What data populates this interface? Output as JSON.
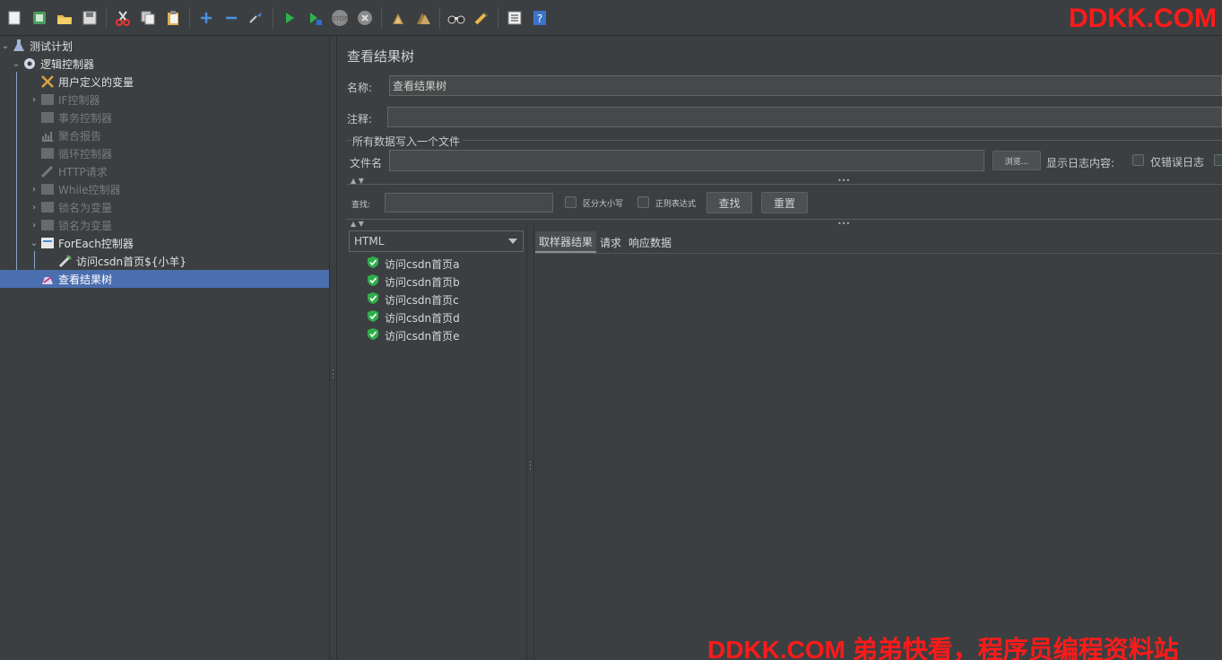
{
  "toolbar": {
    "icons": [
      "new-icon",
      "templates-icon",
      "open-icon",
      "save-icon",
      "cut-icon",
      "copy-icon",
      "paste-icon",
      "expand-icon",
      "collapse-icon",
      "toggle-icon",
      "start-icon",
      "start-no-pause-icon",
      "stop-icon",
      "shutdown-icon",
      "clear-icon",
      "clear-all-icon",
      "search-icon",
      "reset-search-icon",
      "function-helper-icon",
      "help-icon"
    ]
  },
  "watermark_top": "DDKK.COM",
  "tree": {
    "items": [
      {
        "label": "测试计划",
        "icon": "test-plan-icon",
        "disabled": false
      },
      {
        "label": "逻辑控制器",
        "icon": "gear-icon",
        "disabled": false
      },
      {
        "label": "用户定义的变量",
        "icon": "tools-icon",
        "disabled": false
      },
      {
        "label": "IF控制器",
        "icon": "controller-icon",
        "disabled": true
      },
      {
        "label": "事务控制器",
        "icon": "controller-icon",
        "disabled": true
      },
      {
        "label": "聚合报告",
        "icon": "report-icon",
        "disabled": true
      },
      {
        "label": "循环控制器",
        "icon": "controller-icon",
        "disabled": true
      },
      {
        "label": "HTTP请求",
        "icon": "pipette-icon",
        "disabled": true
      },
      {
        "label": "While控制器",
        "icon": "controller-icon",
        "disabled": true
      },
      {
        "label": "锁名为变量",
        "icon": "controller-icon",
        "disabled": true
      },
      {
        "label": "锁名为变量",
        "icon": "controller-icon",
        "disabled": true
      },
      {
        "label": "ForEach控制器",
        "icon": "controller-icon",
        "disabled": false
      },
      {
        "label": "访问csdn首页${小羊}",
        "icon": "pipette-icon",
        "disabled": false
      },
      {
        "label": "查看结果树",
        "icon": "listener-icon",
        "disabled": false
      }
    ]
  },
  "panel": {
    "title": "查看结果树",
    "name_label": "名称:",
    "name_value": "查看结果树",
    "comment_label": "注释:",
    "comment_value": "",
    "file_group_label": "所有数据写入一个文件",
    "filename_label": "文件名",
    "filename_value": "",
    "browse_button": "浏览...",
    "log_display_label": "显示日志内容:",
    "errors_only_label": "仅错误日志",
    "search_label": "查找:",
    "search_value": "",
    "case_sensitive_label": "区分大小写",
    "regex_label": "正则表达式",
    "find_button": "查找",
    "reset_button": "重置",
    "renderer_selected": "HTML",
    "results": [
      "访问csdn首页a",
      "访问csdn首页b",
      "访问csdn首页c",
      "访问csdn首页d",
      "访问csdn首页e"
    ],
    "tabs": [
      "取样器结果",
      "请求",
      "响应数据"
    ]
  },
  "watermark_bottom": "DDKK.COM 弟弟快看，程序员编程资料站"
}
